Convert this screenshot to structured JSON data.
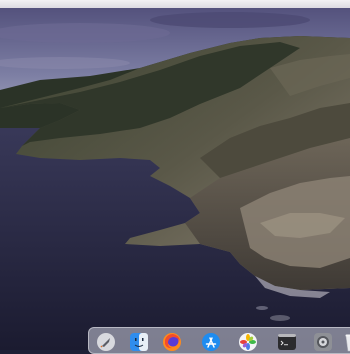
{
  "desktop": {
    "wallpaper": {
      "colors": {
        "sky_top": "#5e5a87",
        "sky_horizon": "#8a8cad",
        "ocean": "#262640",
        "cliff_dark": "#2a3022",
        "cliff_rock": "#7a6f64"
      }
    }
  },
  "dock": {
    "items": [
      {
        "name": "launchpad",
        "icon": "rocket-icon"
      },
      {
        "name": "finder",
        "icon": "finder-icon"
      },
      {
        "name": "firefox",
        "icon": "firefox-icon"
      },
      {
        "name": "app-store",
        "icon": "app-store-icon"
      },
      {
        "name": "photos",
        "icon": "photos-icon"
      },
      {
        "name": "terminal",
        "icon": "terminal-icon"
      },
      {
        "name": "system-preferences",
        "icon": "gear-icon"
      },
      {
        "name": "trash",
        "icon": "trash-icon"
      }
    ]
  }
}
